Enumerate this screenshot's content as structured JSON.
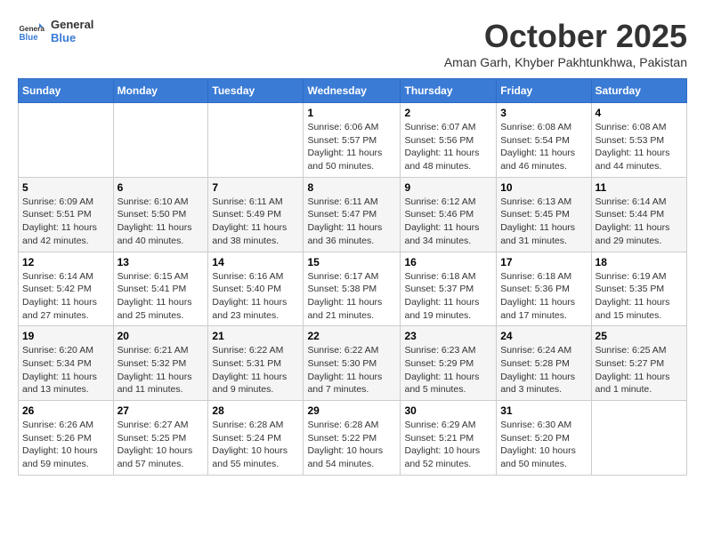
{
  "header": {
    "logo_general": "General",
    "logo_blue": "Blue",
    "month_title": "October 2025",
    "location": "Aman Garh, Khyber Pakhtunkhwa, Pakistan"
  },
  "days_of_week": [
    "Sunday",
    "Monday",
    "Tuesday",
    "Wednesday",
    "Thursday",
    "Friday",
    "Saturday"
  ],
  "weeks": [
    [
      {
        "day": "",
        "info": ""
      },
      {
        "day": "",
        "info": ""
      },
      {
        "day": "",
        "info": ""
      },
      {
        "day": "1",
        "info": "Sunrise: 6:06 AM\nSunset: 5:57 PM\nDaylight: 11 hours and 50 minutes."
      },
      {
        "day": "2",
        "info": "Sunrise: 6:07 AM\nSunset: 5:56 PM\nDaylight: 11 hours and 48 minutes."
      },
      {
        "day": "3",
        "info": "Sunrise: 6:08 AM\nSunset: 5:54 PM\nDaylight: 11 hours and 46 minutes."
      },
      {
        "day": "4",
        "info": "Sunrise: 6:08 AM\nSunset: 5:53 PM\nDaylight: 11 hours and 44 minutes."
      }
    ],
    [
      {
        "day": "5",
        "info": "Sunrise: 6:09 AM\nSunset: 5:51 PM\nDaylight: 11 hours and 42 minutes."
      },
      {
        "day": "6",
        "info": "Sunrise: 6:10 AM\nSunset: 5:50 PM\nDaylight: 11 hours and 40 minutes."
      },
      {
        "day": "7",
        "info": "Sunrise: 6:11 AM\nSunset: 5:49 PM\nDaylight: 11 hours and 38 minutes."
      },
      {
        "day": "8",
        "info": "Sunrise: 6:11 AM\nSunset: 5:47 PM\nDaylight: 11 hours and 36 minutes."
      },
      {
        "day": "9",
        "info": "Sunrise: 6:12 AM\nSunset: 5:46 PM\nDaylight: 11 hours and 34 minutes."
      },
      {
        "day": "10",
        "info": "Sunrise: 6:13 AM\nSunset: 5:45 PM\nDaylight: 11 hours and 31 minutes."
      },
      {
        "day": "11",
        "info": "Sunrise: 6:14 AM\nSunset: 5:44 PM\nDaylight: 11 hours and 29 minutes."
      }
    ],
    [
      {
        "day": "12",
        "info": "Sunrise: 6:14 AM\nSunset: 5:42 PM\nDaylight: 11 hours and 27 minutes."
      },
      {
        "day": "13",
        "info": "Sunrise: 6:15 AM\nSunset: 5:41 PM\nDaylight: 11 hours and 25 minutes."
      },
      {
        "day": "14",
        "info": "Sunrise: 6:16 AM\nSunset: 5:40 PM\nDaylight: 11 hours and 23 minutes."
      },
      {
        "day": "15",
        "info": "Sunrise: 6:17 AM\nSunset: 5:38 PM\nDaylight: 11 hours and 21 minutes."
      },
      {
        "day": "16",
        "info": "Sunrise: 6:18 AM\nSunset: 5:37 PM\nDaylight: 11 hours and 19 minutes."
      },
      {
        "day": "17",
        "info": "Sunrise: 6:18 AM\nSunset: 5:36 PM\nDaylight: 11 hours and 17 minutes."
      },
      {
        "day": "18",
        "info": "Sunrise: 6:19 AM\nSunset: 5:35 PM\nDaylight: 11 hours and 15 minutes."
      }
    ],
    [
      {
        "day": "19",
        "info": "Sunrise: 6:20 AM\nSunset: 5:34 PM\nDaylight: 11 hours and 13 minutes."
      },
      {
        "day": "20",
        "info": "Sunrise: 6:21 AM\nSunset: 5:32 PM\nDaylight: 11 hours and 11 minutes."
      },
      {
        "day": "21",
        "info": "Sunrise: 6:22 AM\nSunset: 5:31 PM\nDaylight: 11 hours and 9 minutes."
      },
      {
        "day": "22",
        "info": "Sunrise: 6:22 AM\nSunset: 5:30 PM\nDaylight: 11 hours and 7 minutes."
      },
      {
        "day": "23",
        "info": "Sunrise: 6:23 AM\nSunset: 5:29 PM\nDaylight: 11 hours and 5 minutes."
      },
      {
        "day": "24",
        "info": "Sunrise: 6:24 AM\nSunset: 5:28 PM\nDaylight: 11 hours and 3 minutes."
      },
      {
        "day": "25",
        "info": "Sunrise: 6:25 AM\nSunset: 5:27 PM\nDaylight: 11 hours and 1 minute."
      }
    ],
    [
      {
        "day": "26",
        "info": "Sunrise: 6:26 AM\nSunset: 5:26 PM\nDaylight: 10 hours and 59 minutes."
      },
      {
        "day": "27",
        "info": "Sunrise: 6:27 AM\nSunset: 5:25 PM\nDaylight: 10 hours and 57 minutes."
      },
      {
        "day": "28",
        "info": "Sunrise: 6:28 AM\nSunset: 5:24 PM\nDaylight: 10 hours and 55 minutes."
      },
      {
        "day": "29",
        "info": "Sunrise: 6:28 AM\nSunset: 5:22 PM\nDaylight: 10 hours and 54 minutes."
      },
      {
        "day": "30",
        "info": "Sunrise: 6:29 AM\nSunset: 5:21 PM\nDaylight: 10 hours and 52 minutes."
      },
      {
        "day": "31",
        "info": "Sunrise: 6:30 AM\nSunset: 5:20 PM\nDaylight: 10 hours and 50 minutes."
      },
      {
        "day": "",
        "info": ""
      }
    ]
  ]
}
